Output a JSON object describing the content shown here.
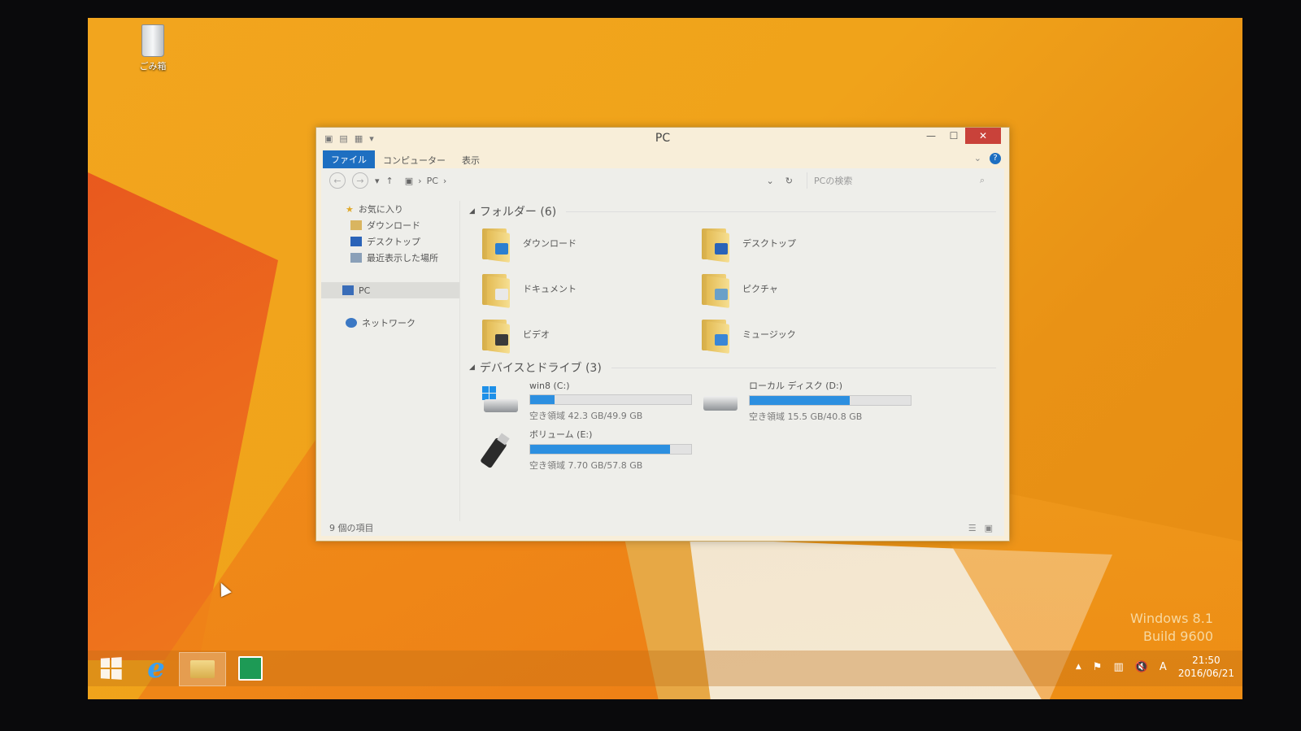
{
  "desktop": {
    "recycle_bin_label": "ごみ箱",
    "watermark_line1": "Windows 8.1",
    "watermark_line2": "Build 9600"
  },
  "window": {
    "title": "PC",
    "ribbon_tabs": [
      "ファイル",
      "コンピューター",
      "表示"
    ],
    "address": {
      "back": "←",
      "forward": "→",
      "up": "↑",
      "path": "PC",
      "refresh": "↻",
      "search_placeholder": "PCの検索"
    },
    "nav_pane": {
      "favorites": "お気に入り",
      "favorite_items": [
        "ダウンロード",
        "デスクトップ",
        "最近表示した場所"
      ],
      "pc": "PC",
      "network": "ネットワーク"
    },
    "folders_group": "フォルダー (6)",
    "folders": [
      {
        "name": "ダウンロード",
        "icon": "download-folder-icon"
      },
      {
        "name": "デスクトップ",
        "icon": "desktop-folder-icon"
      },
      {
        "name": "ドキュメント",
        "icon": "documents-folder-icon"
      },
      {
        "name": "ピクチャ",
        "icon": "pictures-folder-icon"
      },
      {
        "name": "ビデオ",
        "icon": "videos-folder-icon"
      },
      {
        "name": "ミュージック",
        "icon": "music-folder-icon"
      }
    ],
    "drives_group": "デバイスとドライブ (3)",
    "drives": [
      {
        "name": "win8 (C:)",
        "free_text": "空き領域 42.3 GB/49.9 GB",
        "used_fraction": 0.15,
        "icon": "windows-drive-icon"
      },
      {
        "name": "ローカル ディスク (D:)",
        "free_text": "空き領域 15.5 GB/40.8 GB",
        "used_fraction": 0.62,
        "icon": "hard-drive-icon"
      },
      {
        "name": "ボリューム (E:)",
        "free_text": "空き領域 7.70 GB/57.8 GB",
        "used_fraction": 0.87,
        "icon": "usb-drive-icon"
      }
    ],
    "status": "9 個の項目"
  },
  "taskbar": {
    "time": "21:50",
    "date": "2016/06/21",
    "ime": "A"
  },
  "colors": {
    "accent": "#1e6fc1",
    "close": "#c9423a",
    "drive_bar": "#2c8fe0"
  }
}
